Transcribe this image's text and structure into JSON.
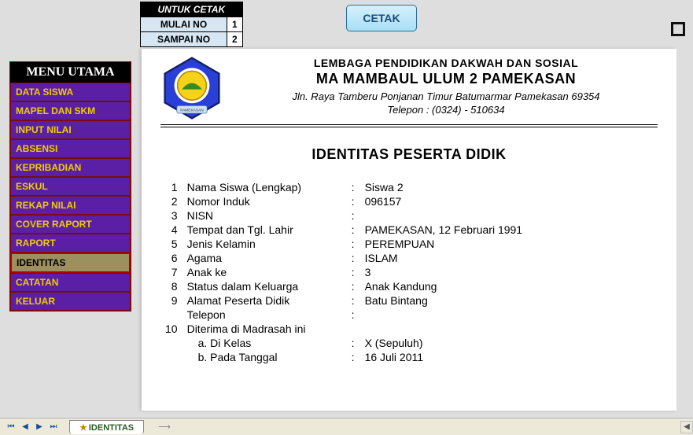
{
  "print": {
    "header": "UNTUK CETAK",
    "row1_label": "MULAI NO",
    "row1_value": "1",
    "row2_label": "SAMPAI NO",
    "row2_value": "2"
  },
  "buttons": {
    "cetak": "CETAK"
  },
  "menu": {
    "header": "MENU UTAMA",
    "items": [
      {
        "label": "DATA SISWA",
        "active": false
      },
      {
        "label": "MAPEL DAN SKM",
        "active": false
      },
      {
        "label": "INPUT NILAI",
        "active": false
      },
      {
        "label": "ABSENSI",
        "active": false
      },
      {
        "label": "KEPRIBADIAN",
        "active": false
      },
      {
        "label": "ESKUL",
        "active": false
      },
      {
        "label": "REKAP NILAI",
        "active": false
      },
      {
        "label": "COVER RAPORT",
        "active": false
      },
      {
        "label": "RAPORT",
        "active": false
      },
      {
        "label": "IDENTITAS",
        "active": true
      },
      {
        "label": "CATATAN",
        "active": false
      },
      {
        "label": "KELUAR",
        "active": false
      }
    ]
  },
  "doc": {
    "inst_line1": "LEMBAGA PENDIDIKAN DAKWAH DAN SOSIAL",
    "inst_line2": "MA MAMBAUL ULUM 2 PAMEKASAN",
    "address": "Jln. Raya Tamberu Ponjanan Timur Batumarmar Pamekasan 69354",
    "phone": "Telepon : (0324) - 510634",
    "title": "IDENTITAS PESERTA DIDIK",
    "rows": [
      {
        "n": "1",
        "label": "Nama Siswa (Lengkap)",
        "value": "Siswa 2"
      },
      {
        "n": "2",
        "label": "Nomor Induk",
        "value": "096157"
      },
      {
        "n": "3",
        "label": "NISN",
        "value": ""
      },
      {
        "n": "4",
        "label": "Tempat dan Tgl. Lahir",
        "value": "PAMEKASAN, 12 Februari 1991"
      },
      {
        "n": "5",
        "label": "Jenis Kelamin",
        "value": "PEREMPUAN"
      },
      {
        "n": "6",
        "label": "Agama",
        "value": "ISLAM"
      },
      {
        "n": "7",
        "label": "Anak ke",
        "value": "3"
      },
      {
        "n": "8",
        "label": "Status dalam Keluarga",
        "value": "Anak Kandung"
      },
      {
        "n": "9",
        "label": "Alamat Peserta Didik",
        "value": "Batu Bintang"
      },
      {
        "n": "",
        "label": "Telepon",
        "value": ""
      },
      {
        "n": "10",
        "label": "Diterima di Madrasah ini",
        "value": ""
      }
    ],
    "sub_a_label": "a.  Di Kelas",
    "sub_a_value": "X (Sepuluh)",
    "sub_b_label": "b.  Pada Tanggal",
    "sub_b_value": "16 Juli 2011"
  },
  "sheet": {
    "active_tab": "IDENTITAS"
  }
}
